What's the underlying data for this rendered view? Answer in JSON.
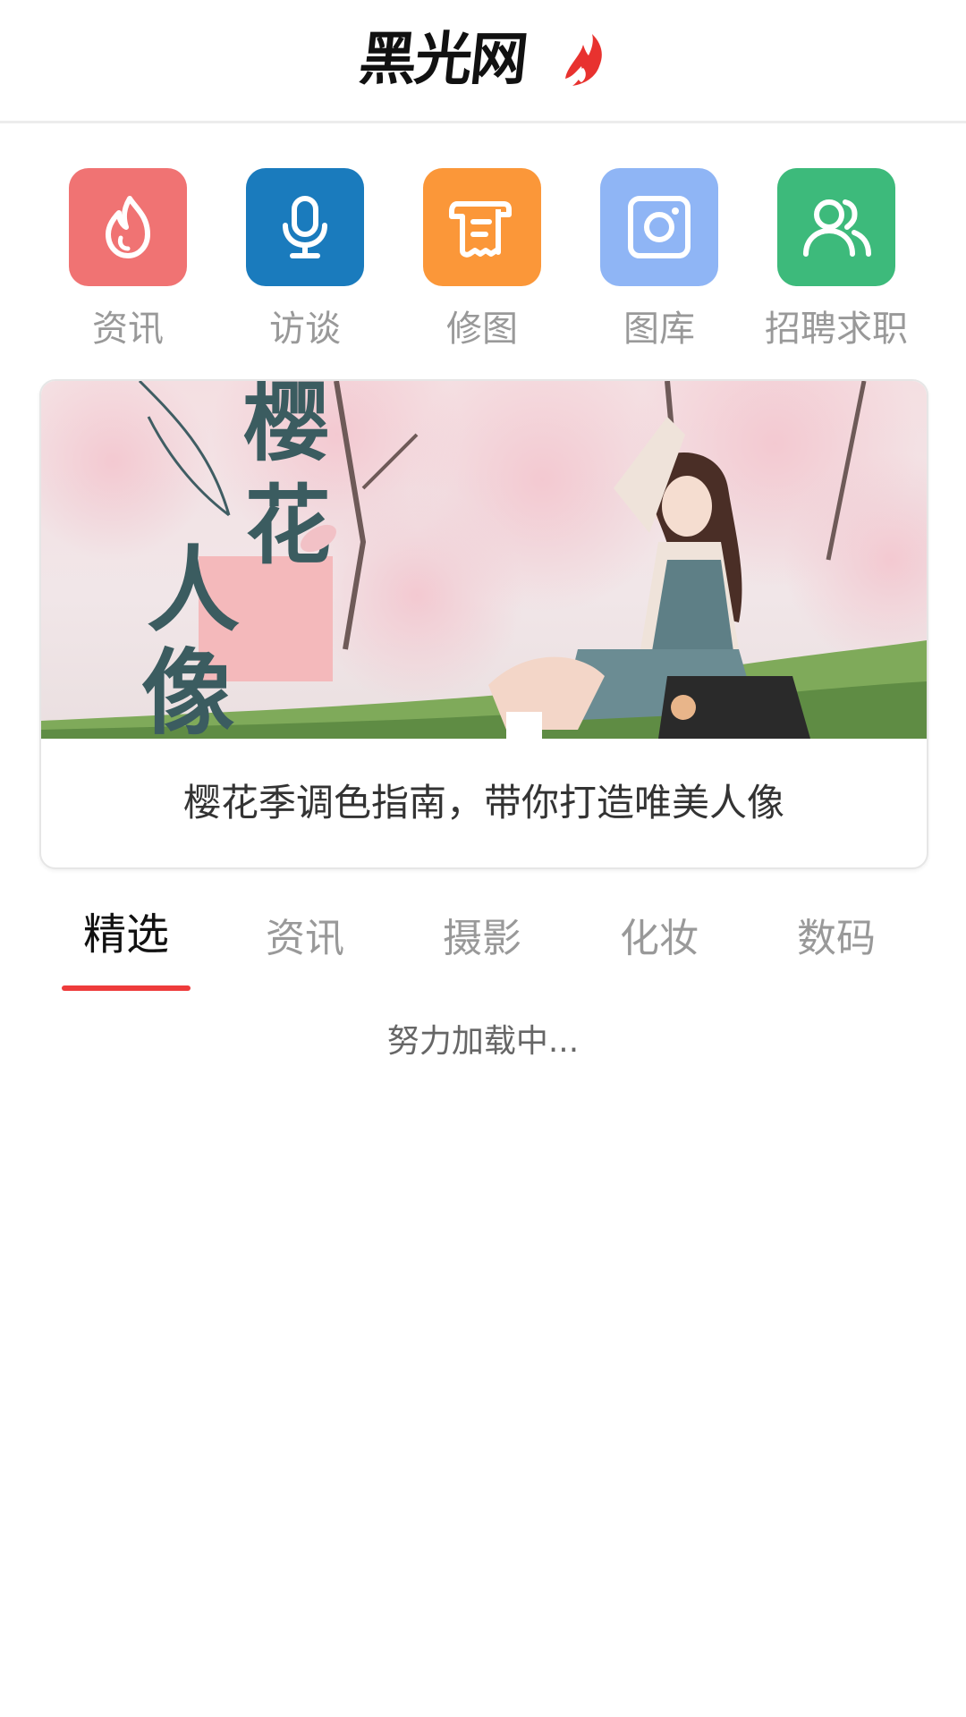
{
  "header": {
    "logo_text": "黑光网",
    "logo_accent_color": "#e8322f"
  },
  "quicknav": {
    "items": [
      {
        "label": "资讯",
        "icon": "flame-icon",
        "color": "#f07373"
      },
      {
        "label": "访谈",
        "icon": "microphone-icon",
        "color": "#1a7bbd"
      },
      {
        "label": "修图",
        "icon": "document-scroll-icon",
        "color": "#fb9739"
      },
      {
        "label": "图库",
        "icon": "camera-frame-icon",
        "color": "#8fb5f5"
      },
      {
        "label": "招聘求职",
        "icon": "users-icon",
        "color": "#3dba7b"
      }
    ]
  },
  "banner": {
    "overlay_chars": [
      "樱",
      "花",
      "人",
      "像"
    ],
    "caption": "樱花季调色指南，带你打造唯美人像"
  },
  "tabs": {
    "items": [
      "精选",
      "资讯",
      "摄影",
      "化妆",
      "数码"
    ],
    "active_index": 0,
    "accent_color": "#ee3b3b"
  },
  "status": {
    "loading_text": "努力加载中..."
  }
}
